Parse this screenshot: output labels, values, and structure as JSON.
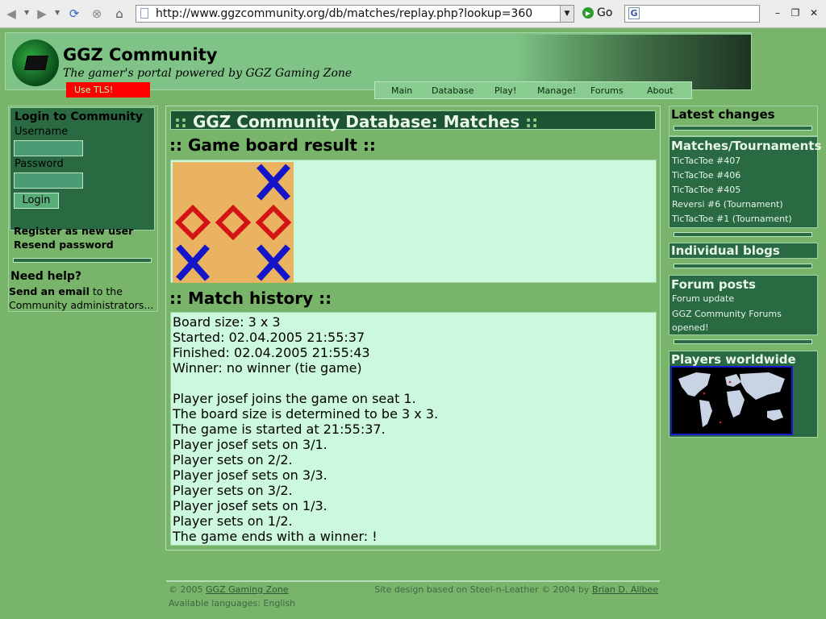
{
  "browser": {
    "url": "http://www.ggzcommunity.org/db/matches/replay.php?lookup=360",
    "go_label": "Go",
    "search_value": ""
  },
  "header": {
    "title": "GGZ Community",
    "tagline": "The gamer's portal powered by GGZ Gaming Zone",
    "tls_label": "Use TLS!",
    "nav": [
      "Main",
      "Database",
      "Play!",
      "Manage!",
      "Forums",
      "About"
    ]
  },
  "login": {
    "title": "Login to Community",
    "username_label": "Username",
    "password_label": "Password",
    "username_value": "",
    "password_value": "",
    "button": "Login",
    "register": "Register as new user",
    "resend": "Resend password"
  },
  "help": {
    "title": "Need help?",
    "link": "Send an email",
    "rest": " to the",
    "line2": "Community administrators..."
  },
  "main": {
    "title_prefix": "::",
    "title": "GGZ Community Database: Matches",
    "title_suffix": "::",
    "board_heading": ":: Game board result ::",
    "history_heading": ":: Match history ::",
    "board": [
      [
        "",
        "",
        "x"
      ],
      [
        "o",
        "o",
        "o"
      ],
      [
        "x",
        "",
        "x"
      ]
    ],
    "history_lines": [
      "Board size: 3 x 3",
      "Started: 02.04.2005 21:55:37",
      "Finished: 02.04.2005 21:55:43",
      "Winner: no winner (tie game)",
      "",
      "Player josef joins the game on seat 1.",
      "The board size is determined to be 3 x 3.",
      "The game is started at 21:55:37.",
      "Player josef sets on 3/1.",
      "Player sets on 2/2.",
      "Player josef sets on 3/3.",
      "Player sets on 3/2.",
      "Player josef sets on 1/3.",
      "Player sets on 1/2.",
      "The game ends with a winner: !"
    ]
  },
  "sidebar": {
    "latest_changes": "Latest changes",
    "matches_heading": "Matches/Tournaments",
    "matches": [
      "TicTacToe #407",
      "TicTacToe #406",
      "TicTacToe #405",
      "Reversi #6 (Tournament)",
      "TicTacToe #1 (Tournament)"
    ],
    "blogs_heading": "Individual blogs",
    "forum_heading": "Forum posts",
    "forum_posts": [
      "Forum update",
      "GGZ Community Forums",
      "opened!"
    ],
    "players_heading": "Players worldwide"
  },
  "footer": {
    "copyright_prefix": "© 2005 ",
    "copyright_link": "GGZ Gaming Zone",
    "languages": "Available languages: English",
    "design_prefix": "Site design based on Steel-n-Leather © 2004 by ",
    "design_link": "Brian D. Allbee"
  },
  "colors": {
    "page_bg": "#78b46a",
    "panel_dark": "#2a6a42",
    "panel_light": "#ccf8de",
    "tls_red": "#ff0000",
    "mark_x": "#1414c8",
    "mark_o": "#d41414",
    "board_bg": "#eab362"
  }
}
